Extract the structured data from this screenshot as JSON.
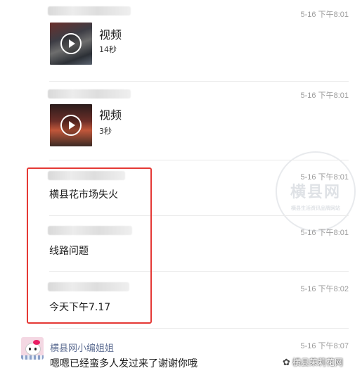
{
  "messages": [
    {
      "time": "5-16 下午8:01",
      "type": "video",
      "video_title": "视频",
      "duration": "14秒"
    },
    {
      "time": "5-16 下午8:01",
      "type": "video",
      "video_title": "视频",
      "duration": "3秒"
    },
    {
      "time": "5-16 下午8:01",
      "type": "text",
      "text": "横县花市场失火"
    },
    {
      "time": "5-16 下午8:01",
      "type": "text",
      "text": "线路问题"
    },
    {
      "time": "5-16 下午8:02",
      "type": "text",
      "text": "今天下午7.17"
    }
  ],
  "reply": {
    "author": "横县网小编姐姐",
    "time": "5-16 下午8:07",
    "text": "嗯嗯已经蛮多人发过来了谢谢你哦",
    "avatar_icon": "hello-kitty-avatar"
  },
  "watermark": {
    "big": "横县网",
    "small": "横县生活资讯品牌网站"
  },
  "footer": {
    "icon": "wechat-icon",
    "label": "横县茉莉花网"
  },
  "colors": {
    "highlight_box": "#e53935",
    "author_name": "#5f6f94",
    "timestamp": "#9b9b9b"
  }
}
